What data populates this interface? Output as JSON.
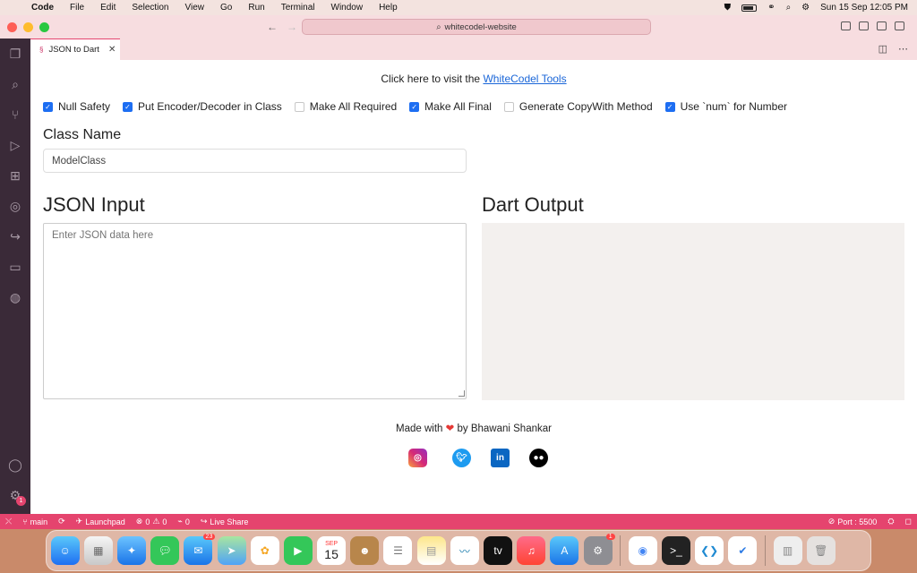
{
  "menubar": {
    "app_name": "Code",
    "items": [
      "File",
      "Edit",
      "Selection",
      "View",
      "Go",
      "Run",
      "Terminal",
      "Window",
      "Help"
    ],
    "datetime": "Sun 15 Sep  12:05 PM"
  },
  "window": {
    "command_center": "whitecodel-website"
  },
  "tab": {
    "label": "JSON to Dart"
  },
  "page": {
    "visit_prefix": "Click here to visit the ",
    "visit_link": "WhiteCodel Tools",
    "options": [
      {
        "label": "Null Safety",
        "checked": true
      },
      {
        "label": "Put Encoder/Decoder in Class",
        "checked": true
      },
      {
        "label": "Make All Required",
        "checked": false
      },
      {
        "label": "Make All Final",
        "checked": true
      },
      {
        "label": "Generate CopyWith Method",
        "checked": false
      },
      {
        "label": "Use `num` for Number",
        "checked": true
      }
    ],
    "class_name_label": "Class Name",
    "class_name_value": "ModelClass",
    "json_input_label": "JSON Input",
    "json_input_placeholder": "Enter JSON data here",
    "dart_output_label": "Dart Output",
    "made_with_prefix": "Made with",
    "made_with_suffix": "by Bhawani Shankar"
  },
  "statusbar": {
    "branch": "main",
    "launchpad": "Launchpad",
    "errors": "0",
    "warnings": "0",
    "ports": "0",
    "live_share": "Live Share",
    "port": "Port : 5500"
  },
  "activity_badge": "1",
  "dock": {
    "mail_badge": "23",
    "calendar_month": "SEP",
    "calendar_day": "15",
    "settings_badge": "1"
  }
}
